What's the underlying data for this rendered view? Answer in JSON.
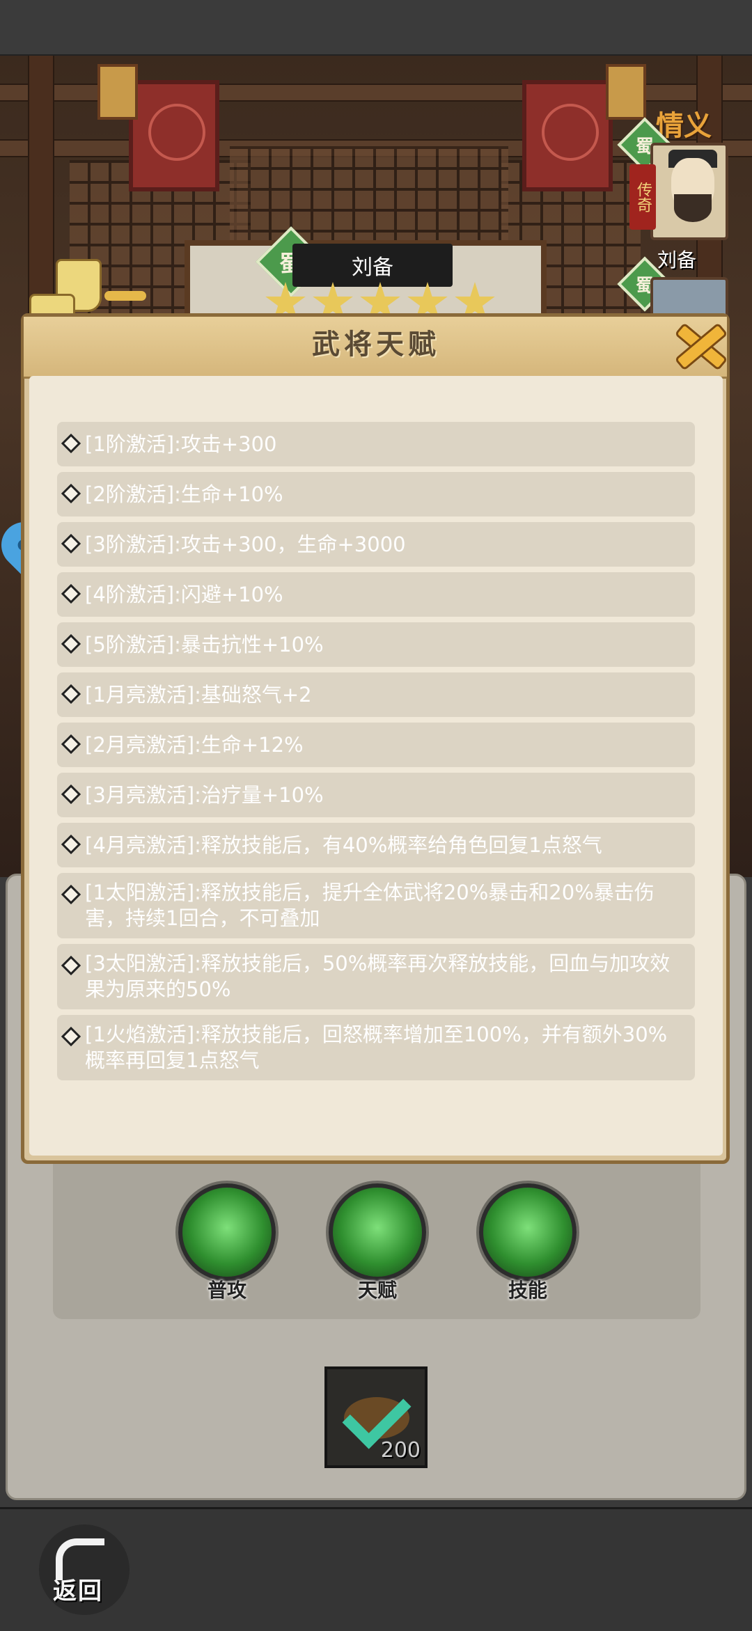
{
  "hero": {
    "faction": "蜀",
    "name": "刘备",
    "stars": 5
  },
  "side_panel": {
    "title": "情义",
    "portraits": [
      {
        "faction": "蜀",
        "tag": "传奇",
        "name": "刘备"
      },
      {
        "faction": "蜀"
      }
    ]
  },
  "modal": {
    "title": "武将天赋",
    "close_icon": "close-icon",
    "talents": [
      "[1阶激活]:攻击+300",
      "[2阶激活]:生命+10%",
      "[3阶激活]:攻击+300，生命+3000",
      "[4阶激活]:闪避+10%",
      "[5阶激活]:暴击抗性+10%",
      "[1月亮激活]:基础怒气+2",
      "[2月亮激活]:生命+12%",
      "[3月亮激活]:治疗量+10%",
      "[4月亮激活]:释放技能后，有40%概率给角色回复1点怒气",
      "[1太阳激活]:释放技能后，提升全体武将20%暴击和20%暴击伤害，持续1回合，不可叠加",
      "[3太阳激活]:释放技能后，50%概率再次释放技能，回血与加攻效果为原来的50%",
      "[1火焰激活]:释放技能后，回怒概率增加至100%，并有额外30%概率再回复1点怒气"
    ]
  },
  "skills": [
    {
      "label": "普攻",
      "icon": "normal-attack-icon"
    },
    {
      "label": "天赋",
      "icon": "talent-icon"
    },
    {
      "label": "技能",
      "icon": "skill-icon"
    }
  ],
  "item": {
    "count": "200",
    "icon": "pouch-check-icon"
  },
  "footer": {
    "back_label": "返回",
    "icon": "back-arrow-icon"
  },
  "colors": {
    "accent": "#f0b53a",
    "shu_green": "#4c9a4c",
    "parchment": "#f0e8d8",
    "row_bg": "#dcd4c4"
  }
}
